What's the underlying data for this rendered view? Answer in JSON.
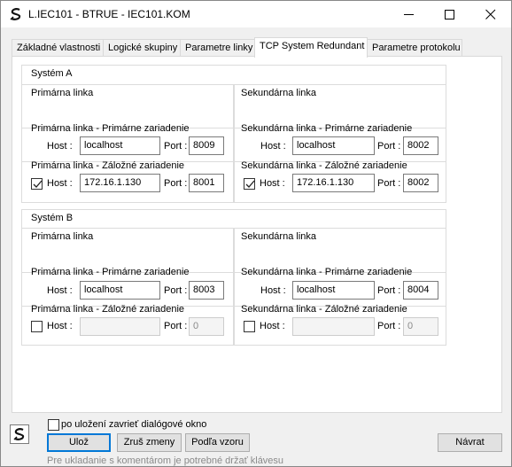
{
  "window": {
    "title": "L.IEC101 - BTRUE - IEC101.KOM",
    "icon": "app-s-icon"
  },
  "tabs": [
    {
      "label": "Základné vlastnosti",
      "active": false
    },
    {
      "label": "Logické skupiny",
      "active": false
    },
    {
      "label": "Parametre linky",
      "active": false
    },
    {
      "label": "TCP System Redundant",
      "active": true
    },
    {
      "label": "Parametre protokolu",
      "active": false
    }
  ],
  "system_a": {
    "title": "Systém A",
    "primary": {
      "title": "Primárna linka",
      "main_title": "Primárna linka - Primárne zariadenie",
      "main_host_label": "Host :",
      "main_host": "localhost",
      "main_port_label": "Port :",
      "main_port": "8009",
      "backup_title": "Primárna linka - Záložné zariadenie",
      "backup_checked": true,
      "backup_host_label": "Host :",
      "backup_host": "172.16.1.130",
      "backup_port_label": "Port :",
      "backup_port": "8001"
    },
    "secondary": {
      "title": "Sekundárna linka",
      "main_title": "Sekundárna linka - Primárne zariadenie",
      "main_host_label": "Host :",
      "main_host": "localhost",
      "main_port_label": "Port :",
      "main_port": "8002",
      "backup_title": "Sekundárna linka - Záložné zariadenie",
      "backup_checked": true,
      "backup_host_label": "Host :",
      "backup_host": "172.16.1.130",
      "backup_port_label": "Port :",
      "backup_port": "8002"
    }
  },
  "system_b": {
    "title": "Systém B",
    "primary": {
      "title": "Primárna linka",
      "main_title": "Primárna linka - Primárne zariadenie",
      "main_host_label": "Host :",
      "main_host": "localhost",
      "main_port_label": "Port :",
      "main_port": "8003",
      "backup_title": "Primárna linka - Záložné zariadenie",
      "backup_checked": false,
      "backup_host_label": "Host :",
      "backup_host": "",
      "backup_port_label": "Port :",
      "backup_port": "0"
    },
    "secondary": {
      "title": "Sekundárna linka",
      "main_title": "Sekundárna linka - Primárne zariadenie",
      "main_host_label": "Host :",
      "main_host": "localhost",
      "main_port_label": "Port :",
      "main_port": "8004",
      "backup_title": "Sekundárna linka - Záložné zariadenie",
      "backup_checked": false,
      "backup_host_label": "Host :",
      "backup_host": "",
      "backup_port_label": "Port :",
      "backup_port": "0"
    }
  },
  "footer": {
    "close_after_save_label": "po uložení zavrieť dialógové okno",
    "close_after_save_checked": false,
    "save_label": "Ulož",
    "discard_label": "Zruš zmeny",
    "template_label": "Podľa vzoru",
    "back_label": "Návrat",
    "hint": "Pre ukladanie s komentárom je potrebné držať klávesu"
  }
}
